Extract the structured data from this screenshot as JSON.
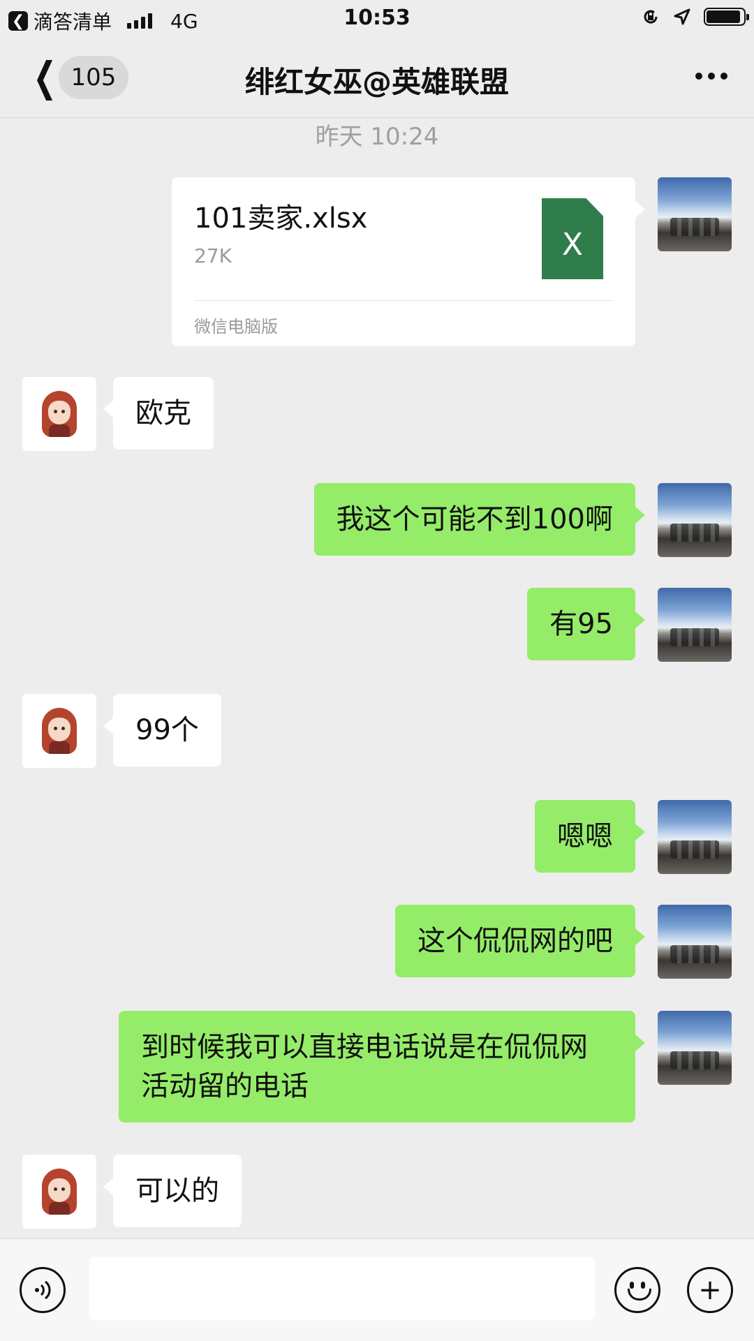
{
  "status_bar": {
    "back_app_label": "滴答清单",
    "network": "4G",
    "time": "10:53",
    "icons": [
      "back-arrow-icon",
      "signal-icon",
      "rotation-lock-icon",
      "location-icon",
      "battery-icon"
    ]
  },
  "nav": {
    "unread_count": "105",
    "title": "绯红女巫@英雄联盟",
    "icons": [
      "back-chevron-icon",
      "more-icon"
    ]
  },
  "chat": {
    "timestamp": "昨天 10:24",
    "file_message": {
      "name": "101卖家.xlsx",
      "size": "27K",
      "source": "微信电脑版",
      "icon_letter": "X",
      "icon_color": "#2f7d4a"
    },
    "messages": [
      {
        "side": "in",
        "text": "欧克"
      },
      {
        "side": "out",
        "text": "我这个可能不到100啊"
      },
      {
        "side": "out",
        "text": "有95"
      },
      {
        "side": "in",
        "text": "99个"
      },
      {
        "side": "out",
        "text": "嗯嗯"
      },
      {
        "side": "out",
        "text": "这个侃侃网的吧"
      },
      {
        "side": "out",
        "text": "到时候我可以直接电话说是在侃侃网活动留的电话"
      },
      {
        "side": "in",
        "text": "可以的"
      }
    ],
    "colors": {
      "outgoing_bubble": "#95ec69",
      "incoming_bubble": "#ffffff",
      "background": "#ededed"
    }
  },
  "input_bar": {
    "icons": [
      "voice-icon",
      "emoji-icon",
      "add-icon"
    ],
    "add_symbol": "+"
  }
}
